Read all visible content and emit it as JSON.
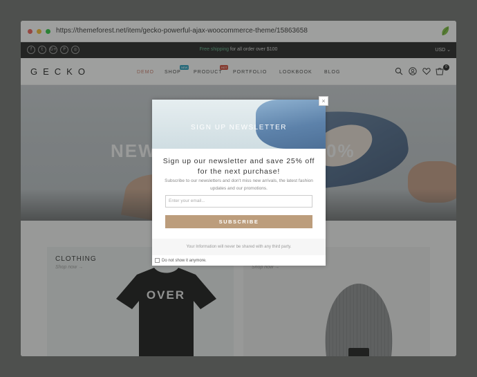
{
  "browser": {
    "url": "https://themeforest.net/item/gecko-powerful-ajax-woocommerce-theme/15863658"
  },
  "topbar": {
    "social": [
      {
        "icon": "facebook-icon",
        "glyph": "f"
      },
      {
        "icon": "twitter-icon",
        "glyph": "t"
      },
      {
        "icon": "google-plus-icon",
        "glyph": "G+"
      },
      {
        "icon": "pinterest-icon",
        "glyph": "P"
      },
      {
        "icon": "instagram-icon",
        "glyph": "◎"
      }
    ],
    "promo_highlight": "Free shipping",
    "promo_rest": " for all order over $100",
    "currency": "USD ⌄"
  },
  "header": {
    "logo": "GECKO",
    "nav": [
      {
        "label": "DEMO",
        "active": true
      },
      {
        "label": "SHOP",
        "badge": "NEW"
      },
      {
        "label": "PRODUCT",
        "badge": "HOT"
      },
      {
        "label": "PORTFOLIO"
      },
      {
        "label": "LOOKBOOK"
      },
      {
        "label": "BLOG"
      }
    ],
    "cart_count": "0"
  },
  "hero": {
    "left_text": "NEW",
    "right_text": "0%"
  },
  "cards": {
    "left": {
      "title": "CLOTHING",
      "link": "Shop now →",
      "tshirt_text": "OVER"
    },
    "right": {
      "link": "Shop now →"
    }
  },
  "modal": {
    "close": "×",
    "banner_title": "SIGN UP NEWSLETTER",
    "heading": "Sign up our newsletter and save 25% off for the next purchase!",
    "description": "Subscribe to our newsletters and don't miss new arrivals, the latest fashion updates and our promotions.",
    "email_placeholder": "Enter your email...",
    "subscribe_label": "SUBSCRIBE",
    "privacy_note": "Your Information will never be shared with any third party.",
    "dont_show_label": "Do not show it anymore."
  },
  "colors": {
    "accent": "#bc9d7c",
    "active_nav": "#c97a6a",
    "badge_new": "#2aa1c0",
    "badge_hot": "#d44b3a"
  }
}
